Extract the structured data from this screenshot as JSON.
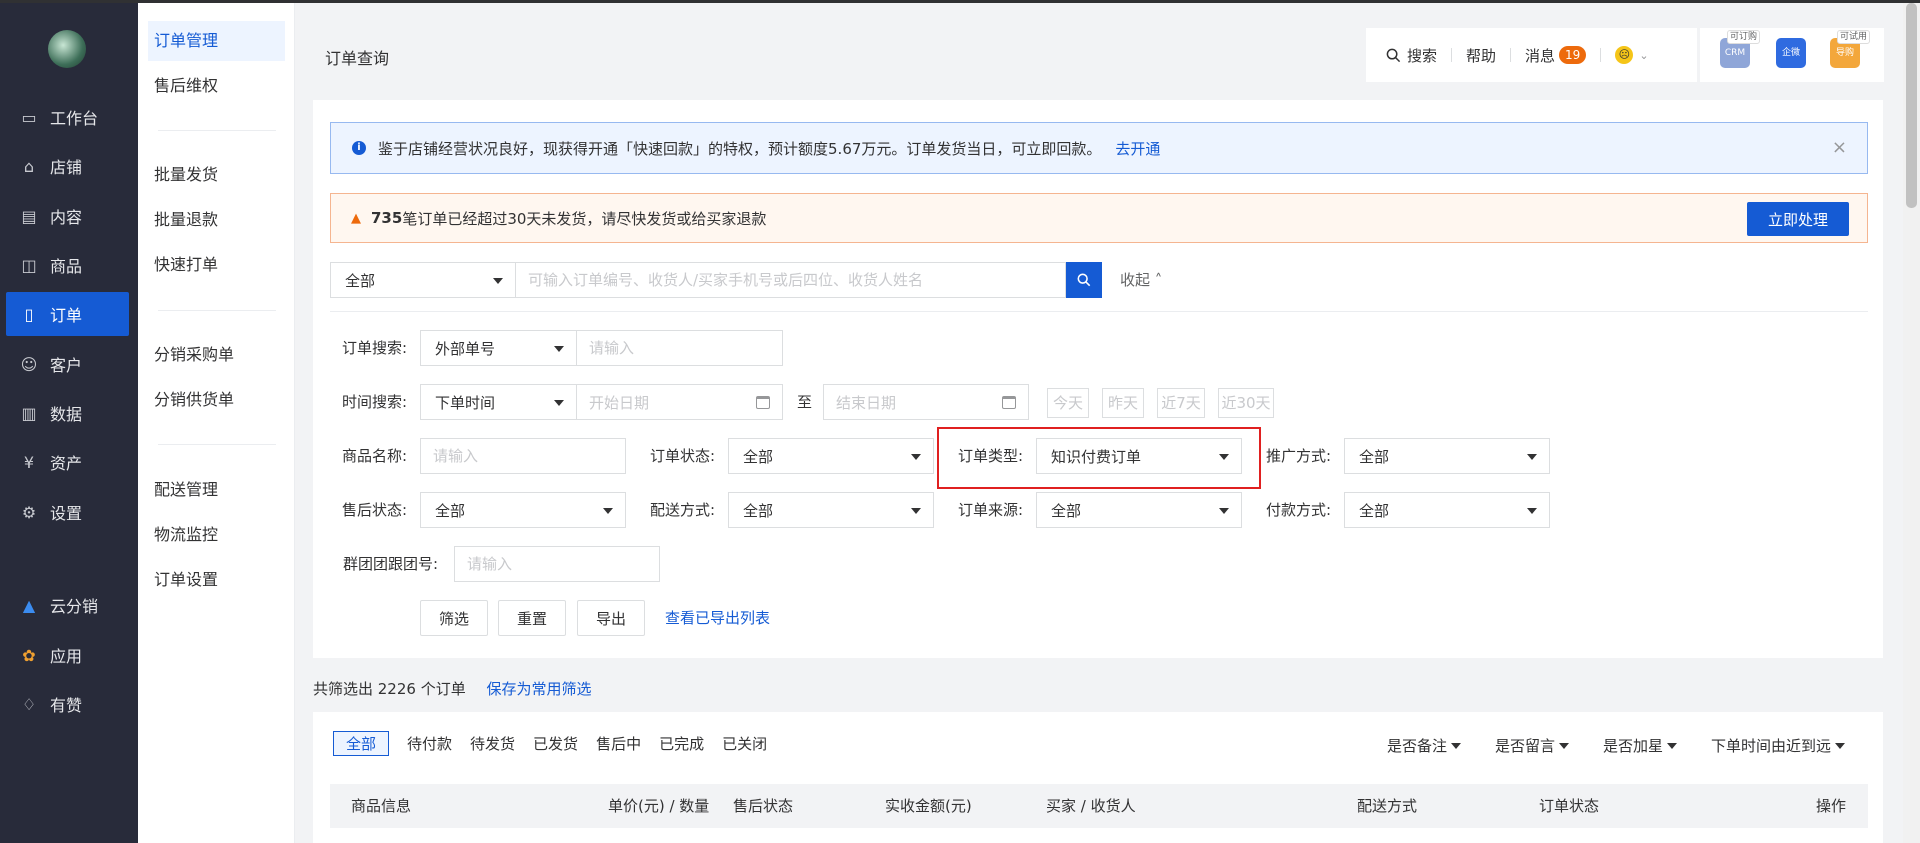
{
  "nav": {
    "items": [
      {
        "label": "工作台",
        "icon": "desktop-icon"
      },
      {
        "label": "店铺",
        "icon": "store-icon"
      },
      {
        "label": "内容",
        "icon": "document-icon"
      },
      {
        "label": "商品",
        "icon": "bag-icon"
      },
      {
        "label": "订单",
        "icon": "order-icon"
      },
      {
        "label": "客户",
        "icon": "user-icon"
      },
      {
        "label": "数据",
        "icon": "chart-icon"
      },
      {
        "label": "资产",
        "icon": "yen-icon"
      },
      {
        "label": "设置",
        "icon": "gear-icon"
      }
    ],
    "bottom_items": [
      {
        "label": "云分销",
        "icon": "cloud-distribution-icon"
      },
      {
        "label": "应用",
        "icon": "apps-icon"
      },
      {
        "label": "有赞",
        "icon": "thumb-up-icon"
      }
    ]
  },
  "submenu": {
    "groups": [
      [
        "订单管理",
        "售后维权"
      ],
      [
        "批量发货",
        "批量退款",
        "快速打单"
      ],
      [
        "分销采购单",
        "分销供货单"
      ],
      [
        "配送管理",
        "物流监控",
        "订单设置"
      ]
    ]
  },
  "header": {
    "title": "订单查询",
    "search": "搜索",
    "help": "帮助",
    "messages": "消息",
    "message_count": "19",
    "apps": [
      {
        "name": "CRM",
        "tag": "可订购",
        "color": "#8fa6d8"
      },
      {
        "name": "企微",
        "tag": "",
        "color": "#2f6be0"
      },
      {
        "name": "导购",
        "tag": "可试用",
        "color": "#f3a73b"
      }
    ]
  },
  "notice": {
    "text": "鉴于店铺经营状况良好，现获得开通「快速回款」的特权，预计额度5.67万元。订单发货当日，可立即回款。",
    "link": "去开通"
  },
  "warning": {
    "count": "735",
    "text": "笔订单已经超过30天未发货，请尽快发货或给买家退款",
    "button": "立即处理"
  },
  "searchbar": {
    "scope": "全部",
    "placeholder": "可输入订单编号、收货人/买家手机号或后四位、收货人姓名",
    "collapse": "收起"
  },
  "form": {
    "order_search_label": "订单搜索:",
    "order_search_type": "外部单号",
    "order_search_placeholder": "请输入",
    "time_label": "时间搜索:",
    "time_type": "下单时间",
    "start_placeholder": "开始日期",
    "to": "至",
    "end_placeholder": "结束日期",
    "quick_dates": [
      "今天",
      "昨天",
      "近7天",
      "近30天"
    ],
    "product_label": "商品名称:",
    "product_placeholder": "请输入",
    "status_label": "订单状态:",
    "status_value": "全部",
    "type_label": "订单类型:",
    "type_value": "知识付费订单",
    "promo_label": "推广方式:",
    "promo_value": "全部",
    "aftersale_label": "售后状态:",
    "aftersale_value": "全部",
    "delivery_label": "配送方式:",
    "delivery_value": "全部",
    "source_label": "订单来源:",
    "source_value": "全部",
    "payment_label": "付款方式:",
    "payment_value": "全部",
    "group_label": "群团团跟团号:",
    "group_placeholder": "请输入",
    "filter_btn": "筛选",
    "reset_btn": "重置",
    "export_btn": "导出",
    "export_list_link": "查看已导出列表"
  },
  "summary": {
    "text": "共筛选出 2226 个订单",
    "save_link": "保存为常用筛选"
  },
  "tabs": [
    "全部",
    "待付款",
    "待发货",
    "已发货",
    "售后中",
    "已完成",
    "已关闭"
  ],
  "list_filters": [
    "是否备注",
    "是否留言",
    "是否加星",
    "下单时间由近到远"
  ],
  "table_headers": [
    "商品信息",
    "单价(元) / 数量",
    "售后状态",
    "实收金额(元)",
    "买家 / 收货人",
    "配送方式",
    "订单状态",
    "操作"
  ]
}
